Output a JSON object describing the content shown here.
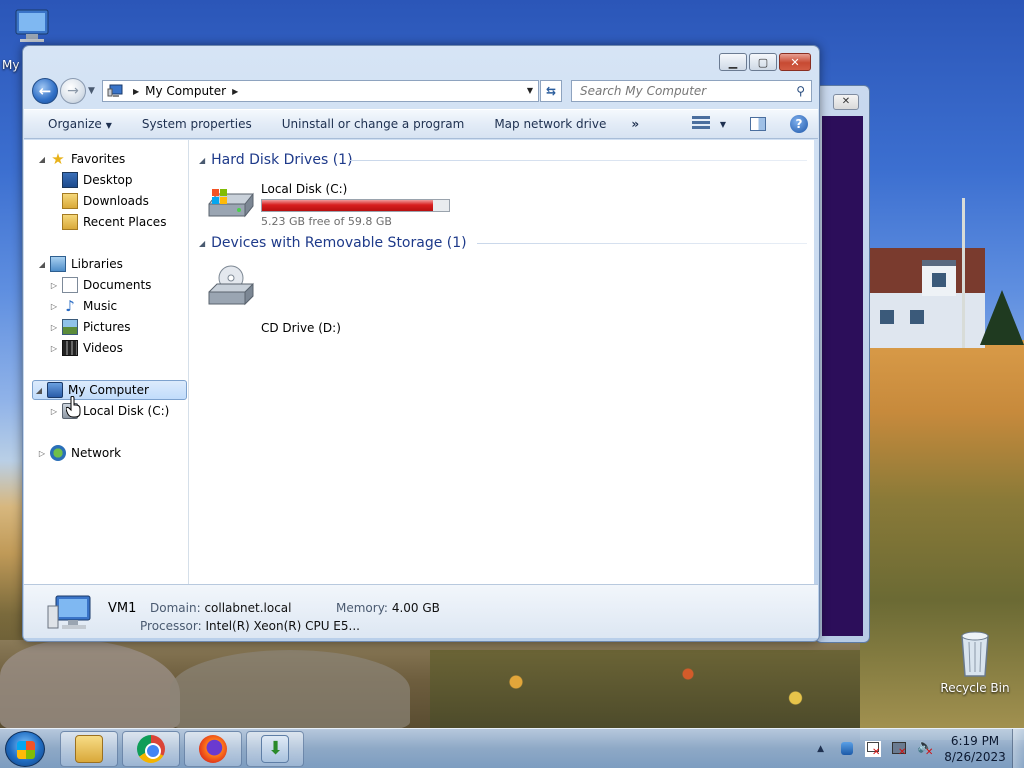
{
  "desktop": {
    "icons": [
      {
        "label": "My",
        "icon": "computer-icon"
      },
      {
        "label": "Recycle Bin",
        "icon": "recycle-bin-icon"
      }
    ]
  },
  "window": {
    "address": {
      "path": [
        "My Computer"
      ]
    },
    "search": {
      "placeholder": "Search My Computer"
    },
    "commands": {
      "organize": "Organize",
      "system_properties": "System properties",
      "uninstall": "Uninstall or change a program",
      "map_drive": "Map network drive",
      "more": "»"
    },
    "navpane": {
      "favorites": {
        "label": "Favorites",
        "items": [
          "Desktop",
          "Downloads",
          "Recent Places"
        ]
      },
      "libraries": {
        "label": "Libraries",
        "items": [
          "Documents",
          "Music",
          "Pictures",
          "Videos"
        ]
      },
      "computer": {
        "label": "My Computer",
        "items": [
          "Local Disk (C:)"
        ],
        "selected": true
      },
      "network": {
        "label": "Network"
      }
    },
    "groups": {
      "hard_disks": {
        "title": "Hard Disk Drives (1)",
        "drives": [
          {
            "name": "Local Disk (C:)",
            "free_text": "5.23 GB free of 59.8 GB",
            "used_fraction": 0.9125
          }
        ]
      },
      "removable": {
        "title": "Devices with Removable Storage (1)",
        "drives": [
          {
            "name": "CD Drive (D:)"
          }
        ]
      }
    },
    "details": {
      "name": "VM1",
      "domain_label": "Domain:",
      "domain": "collabnet.local",
      "memory_label": "Memory:",
      "memory": "4.00 GB",
      "processor_label": "Processor:",
      "processor": "Intel(R) Xeon(R) CPU E5..."
    }
  },
  "taskbar": {
    "pinned": [
      "Windows Explorer",
      "Google Chrome",
      "Firefox",
      "App"
    ],
    "clock": {
      "time": "6:19 PM",
      "date": "8/26/2023"
    }
  },
  "colors": {
    "accent": "#1e3a8a",
    "disk_bar": "#d81e1e",
    "selection": "#c1dcfb"
  }
}
